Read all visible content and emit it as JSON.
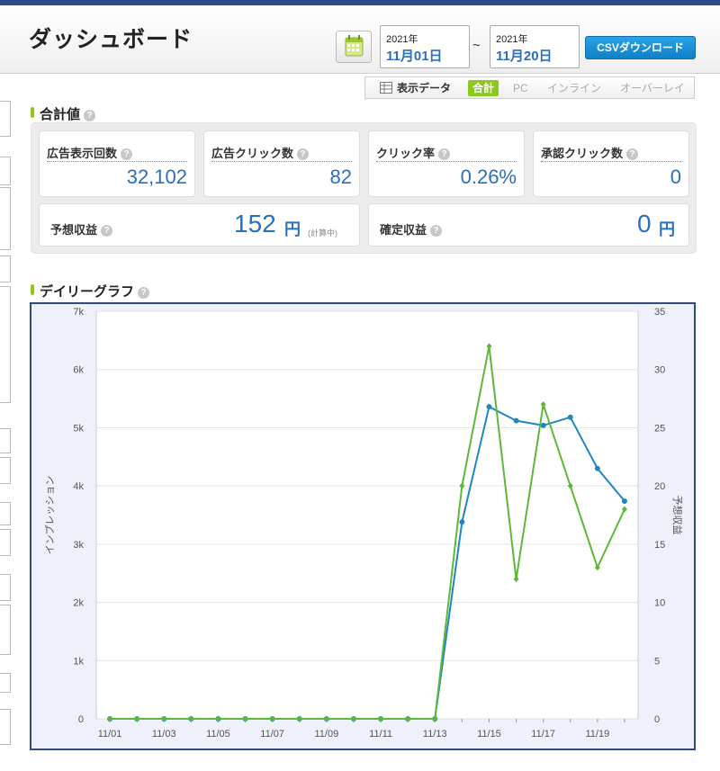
{
  "header": {
    "title": "ダッシュボード",
    "start_date": {
      "year": "2021年",
      "month_day": "11月01日"
    },
    "end_date": {
      "year": "2021年",
      "month_day": "11月20日"
    },
    "range_separator": "~",
    "csv_button": "CSVダウンロード"
  },
  "tabs": {
    "label": "表示データ",
    "items": [
      "合計",
      "PC",
      "インライン",
      "オーバーレイ"
    ],
    "active": "合計"
  },
  "summary": {
    "title": "合計値",
    "help": "?",
    "cards": [
      {
        "label": "広告表示回数",
        "value": "32,102"
      },
      {
        "label": "広告クリック数",
        "value": "82"
      },
      {
        "label": "クリック率",
        "value": "0.26%"
      },
      {
        "label": "承認クリック数",
        "value": "0"
      }
    ],
    "estimated": {
      "label": "予想収益",
      "value": "152",
      "unit": "円",
      "note": "(計算中)"
    },
    "confirmed": {
      "label": "確定収益",
      "value": "0",
      "unit": "円"
    }
  },
  "graph_section": {
    "title": "デイリーグラフ"
  },
  "colors": {
    "accent_green": "#8cc81e",
    "value_blue": "#2a6fba",
    "series_impressions": "#1f86c4",
    "series_revenue": "#5db83a",
    "frame_navy": "#2f4a7a"
  },
  "chart_data": {
    "type": "line",
    "x": [
      "11/01",
      "11/02",
      "11/03",
      "11/04",
      "11/05",
      "11/06",
      "11/07",
      "11/08",
      "11/09",
      "11/10",
      "11/11",
      "11/12",
      "11/13",
      "11/14",
      "11/15",
      "11/16",
      "11/17",
      "11/18",
      "11/19",
      "11/20"
    ],
    "x_tick_labels": [
      "11/01",
      "11/03",
      "11/05",
      "11/07",
      "11/09",
      "11/11",
      "11/13",
      "11/15",
      "11/17",
      "11/19"
    ],
    "ylabel_left": "インプレッション",
    "ylabel_right": "予想収益",
    "ylim_left": [
      0,
      7000
    ],
    "ylim_right": [
      0,
      35
    ],
    "y_tick_labels_left": [
      "0",
      "1k",
      "2k",
      "3k",
      "4k",
      "5k",
      "6k",
      "7k"
    ],
    "y_tick_labels_right": [
      "0",
      "5",
      "10",
      "15",
      "20",
      "25",
      "30",
      "35"
    ],
    "grid": true,
    "series": [
      {
        "axis": "left",
        "color": "#1f86c4",
        "values": [
          0,
          0,
          0,
          0,
          0,
          0,
          0,
          0,
          0,
          0,
          0,
          0,
          0,
          3380,
          5360,
          5120,
          5040,
          5180,
          4300,
          3740
        ]
      },
      {
        "axis": "right",
        "color": "#5db83a",
        "values": [
          0,
          0,
          0,
          0,
          0,
          0,
          0,
          0,
          0,
          0,
          0,
          0,
          0,
          20,
          32,
          12,
          27,
          20,
          13,
          18
        ]
      }
    ]
  }
}
